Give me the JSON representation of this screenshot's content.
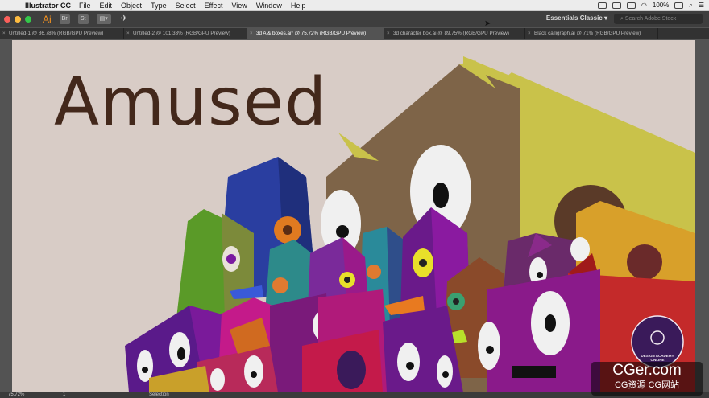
{
  "menubar": {
    "app": "Illustrator CC",
    "items": [
      "File",
      "Edit",
      "Object",
      "Type",
      "Select",
      "Effect",
      "View",
      "Window",
      "Help"
    ],
    "battery": "100%"
  },
  "toolbar": {
    "logo": "Ai",
    "br": "Br",
    "st": "St",
    "workspace": "Essentials Classic",
    "search_placeholder": "Search Adobe Stock"
  },
  "tabs": [
    {
      "label": "Untitled-1 @ 86.78% (RGB/GPU Preview)"
    },
    {
      "label": "Untitled-2 @ 101.33% (RGB/GPU Preview)"
    },
    {
      "label": "3d A & boxes.ai* @ 75.72% (RGB/GPU Preview)"
    },
    {
      "label": "3d character box.ai @ 89.75% (RGB/GPU Preview)"
    },
    {
      "label": "Black calligraph.ai @ 71% (RGB/GPU Preview)"
    }
  ],
  "artwork": {
    "headline": "Amused",
    "badge_line1": "DESIGN ACADEMY",
    "badge_line2": "ONLINE"
  },
  "status": {
    "zoom": "75.72%",
    "page": "1",
    "tool": "Selection"
  },
  "watermark": {
    "line1": "CGer.com",
    "line2": "CG资源 CG网站"
  },
  "colors": {
    "canvas": "#d8ccc6",
    "headline": "#43281b",
    "accent": "#f7931e"
  }
}
